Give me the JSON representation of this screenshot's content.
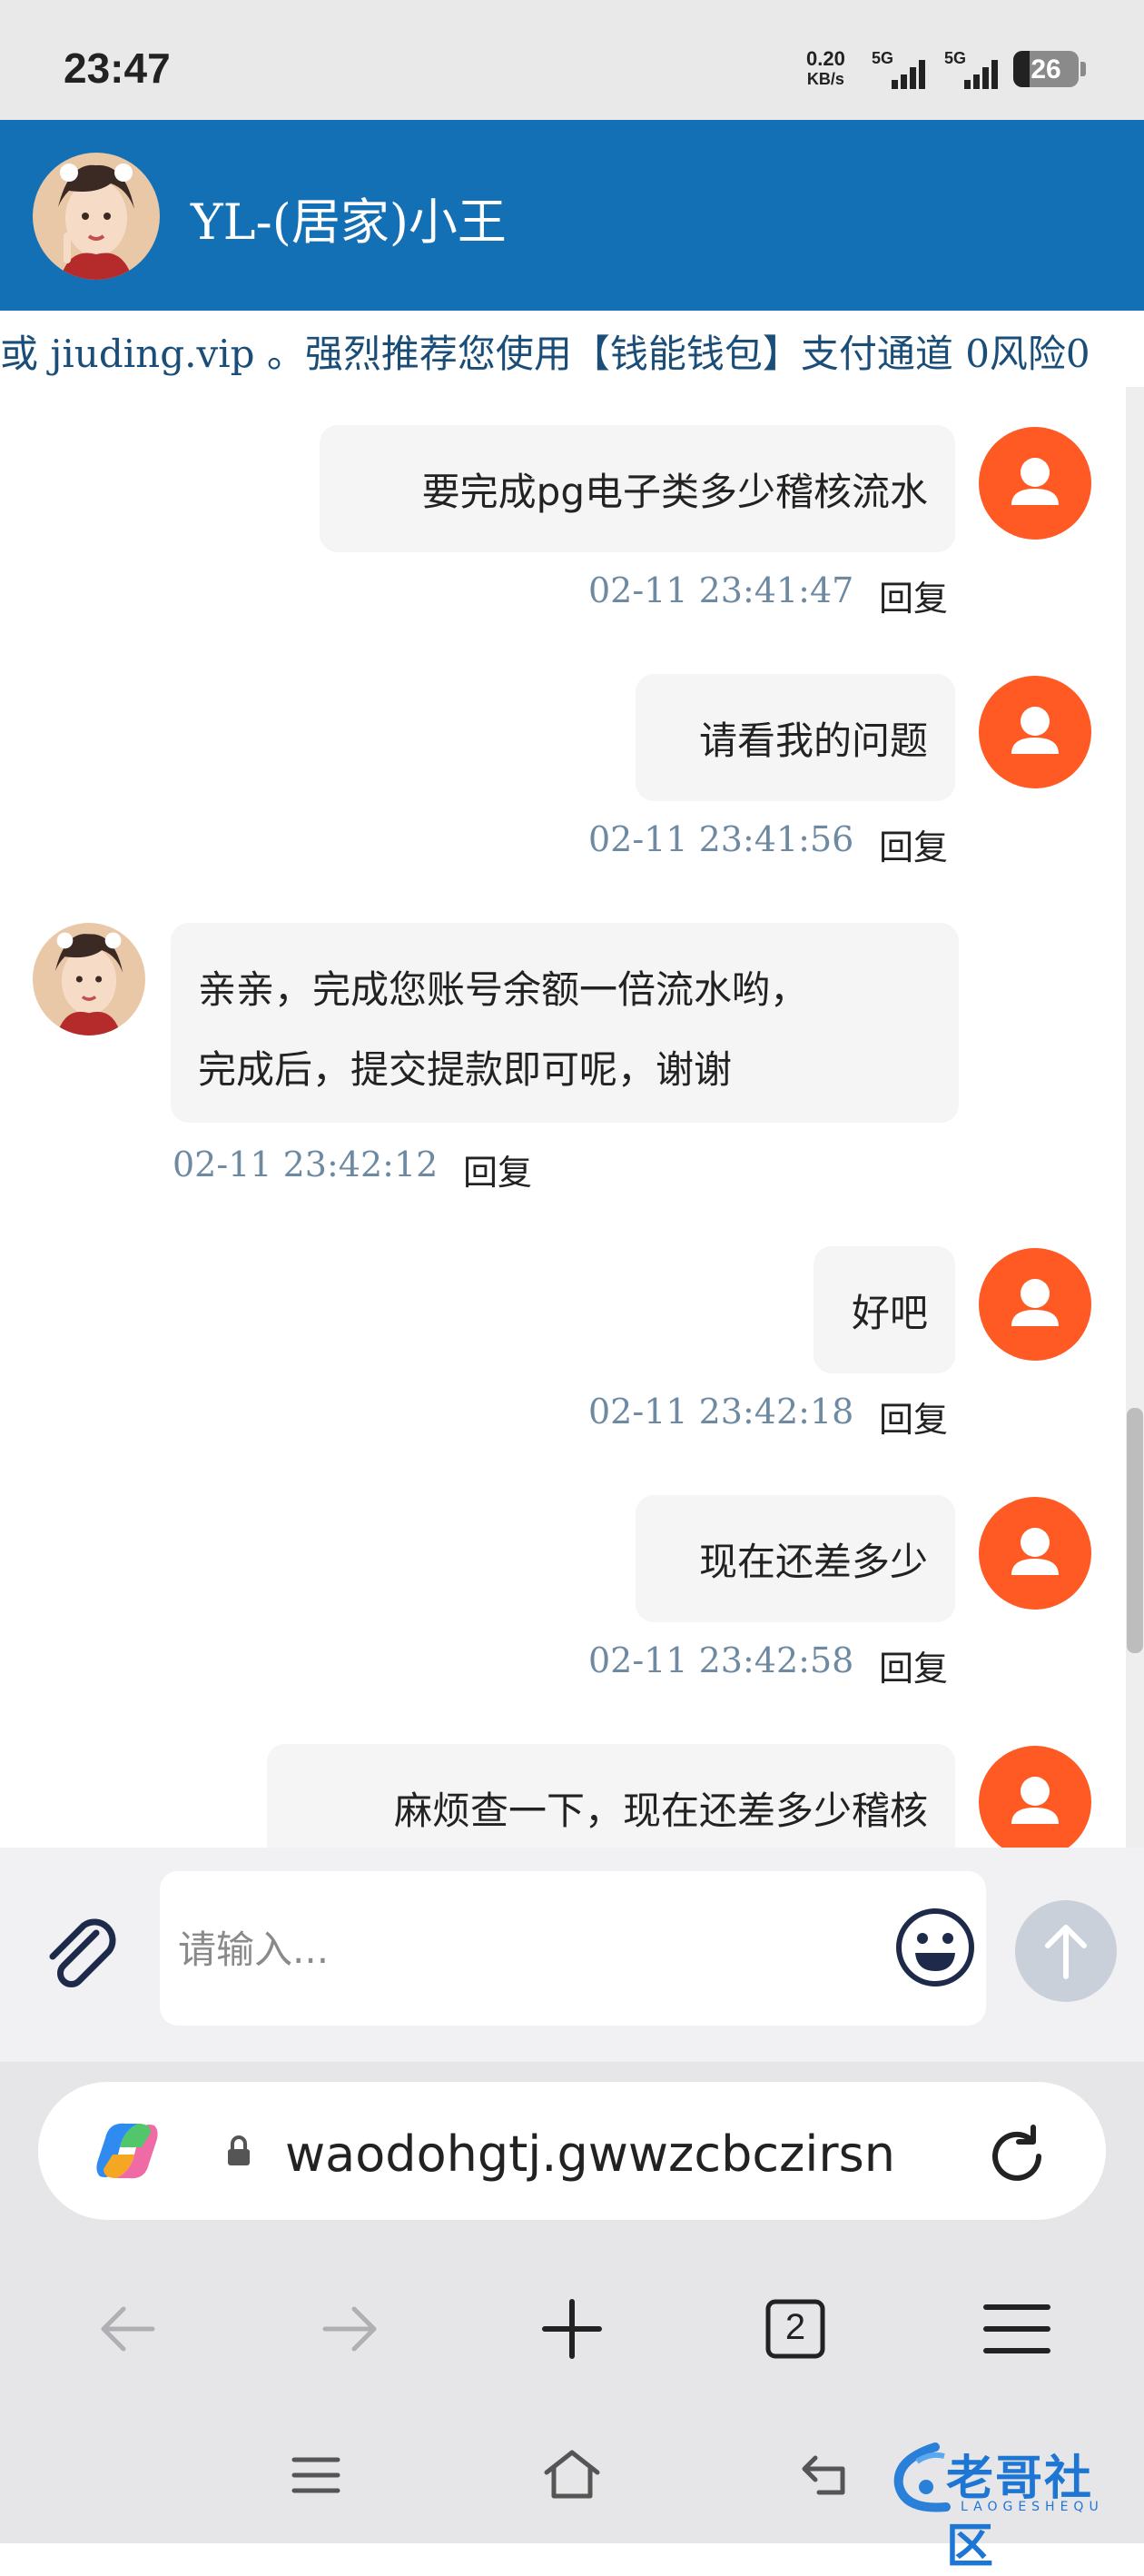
{
  "status_bar": {
    "time": "23:47",
    "net_speed_value": "0.20",
    "net_speed_unit": "KB/s",
    "sim1_label": "5G",
    "sim2_label": "5G",
    "battery": "26"
  },
  "chat": {
    "title": "YL-(居家)小王",
    "marquee": "或 jiuding.vip 。强烈推荐您使用【钱能钱包】支付通道 0风险0",
    "messages": [
      {
        "side": "right",
        "text": "要完成pg电子类多少稽核流水",
        "time": "02-11 23:41:47",
        "reply": "回复"
      },
      {
        "side": "right",
        "text": "请看我的问题",
        "time": "02-11 23:41:56",
        "reply": "回复"
      },
      {
        "side": "left",
        "line1": "亲亲，完成您账号余额一倍流水哟，",
        "line2": "完成后，提交提款即可呢，谢谢",
        "time": "02-11 23:42:12",
        "reply": "回复"
      },
      {
        "side": "right",
        "text": "好吧",
        "time": "02-11 23:42:18",
        "reply": "回复"
      },
      {
        "side": "right",
        "text": "现在还差多少",
        "time": "02-11 23:42:58",
        "reply": "回复"
      },
      {
        "side": "right",
        "text": "麻烦查一下，现在还差多少稽核",
        "time": "",
        "reply": ""
      }
    ]
  },
  "input": {
    "placeholder": "请输入..."
  },
  "browser": {
    "url": "waodohgtj.gwwzcbczirsn",
    "tab_count": "2"
  },
  "watermark": {
    "text": "老哥社区",
    "subtext": "LAOGESHEQU"
  },
  "colors": {
    "header_bg": "#1470b5",
    "user_avatar": "#ff5a23",
    "timestamp": "#6e8aa3",
    "bubble_bg": "#f5f5f5"
  }
}
